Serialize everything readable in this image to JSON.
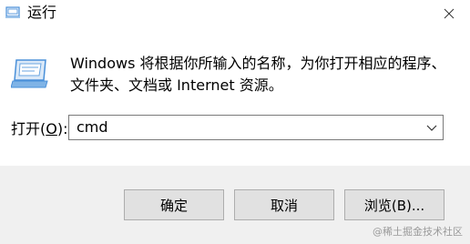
{
  "window": {
    "title": "运行"
  },
  "icons": {
    "title_icon": "run-icon",
    "close": "close-icon",
    "combo_arrow": "chevron-down-icon"
  },
  "content": {
    "description": "Windows 将根据你所输入的名称，为你打开相应的程序、文件夹、文档或 Internet 资源。",
    "open_label_prefix": "打开(",
    "open_label_key": "O",
    "open_label_suffix": "):",
    "combo_value": "cmd"
  },
  "buttons": {
    "ok": "确定",
    "cancel": "取消",
    "browse": "浏览(B)..."
  },
  "watermark": "@稀土掘金技术社区",
  "colors": {
    "footer_bg": "#f0f0f0",
    "button_bg": "#e1e1e1",
    "button_border": "#adadad",
    "icon_blue": "#4a90d9"
  }
}
